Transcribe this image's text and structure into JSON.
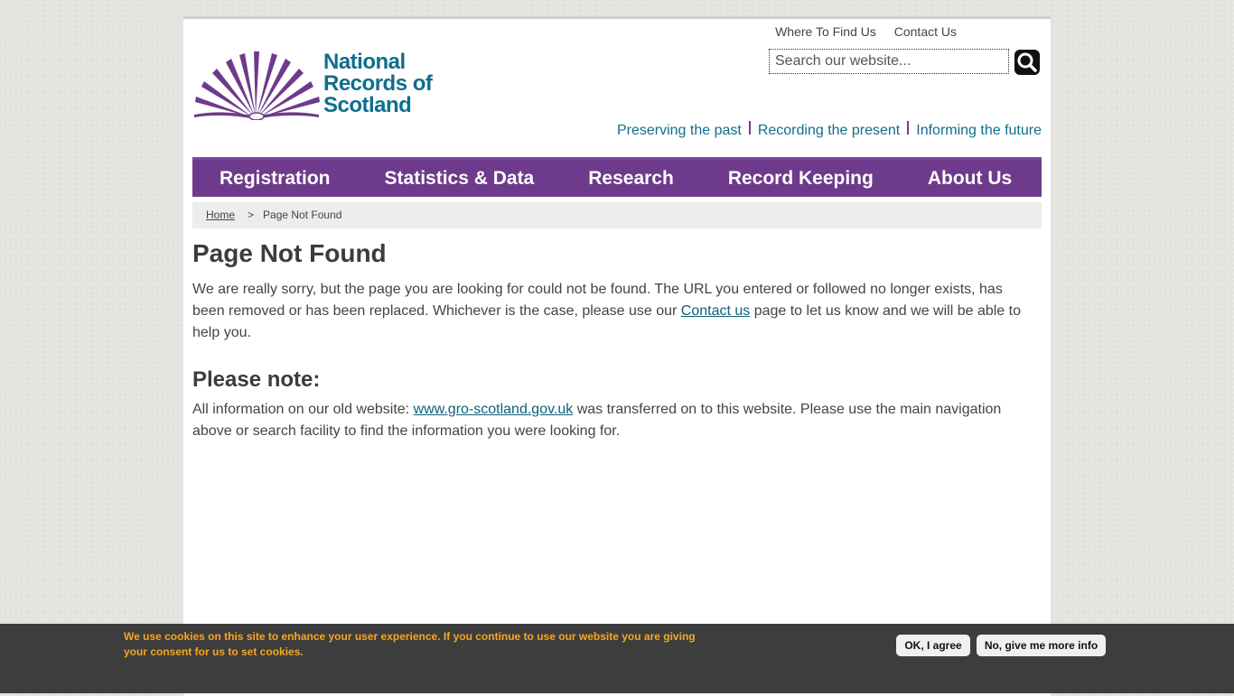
{
  "top_links": [
    "Where To Find Us",
    "Contact Us"
  ],
  "logo": {
    "lines": [
      "National",
      "Records of",
      "Scotland"
    ]
  },
  "search": {
    "placeholder": "Search our website..."
  },
  "tagline": [
    "Preserving the past",
    "Recording the present",
    "Informing the future"
  ],
  "nav": [
    "Registration",
    "Statistics & Data",
    "Research",
    "Record Keeping",
    "About Us"
  ],
  "breadcrumb": {
    "home": "Home",
    "separator": ">",
    "current": "Page Not Found"
  },
  "main": {
    "title": "Page Not Found",
    "para1_a": "We are really sorry, but the page you are looking for could not be found. The URL you entered or followed no longer exists, has been removed or has been replaced. Whichever is the case, please use our ",
    "para1_link": "Contact us",
    "para1_b": " page to let us know and we will be able to help you.",
    "note_heading": "Please note:",
    "para2_a": "All information on our old website: ",
    "para2_link": "www.gro-scotland.gov.uk",
    "para2_b": " was transferred on to this website. Please use the main navigation above or search facility to find the information you were looking for."
  },
  "cookie": {
    "text": "We use cookies on this site to enhance your user experience. If you continue to use our website you are giving your consent for us to set cookies.",
    "agree_label": "OK, I agree",
    "info_label": "No, give me more info"
  },
  "colors": {
    "brand_purple": "#6e3a8c",
    "brand_teal": "#0f6e8c",
    "cookie_text": "#f5a623"
  }
}
